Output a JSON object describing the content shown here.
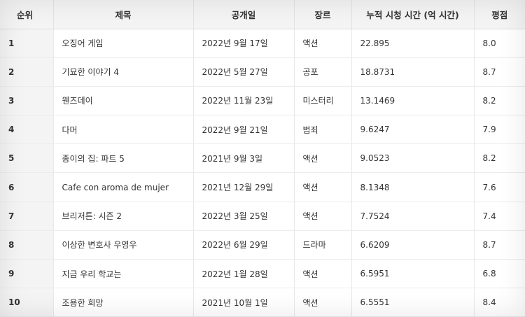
{
  "table": {
    "headers": [
      "순위",
      "제목",
      "공개일",
      "장르",
      "누적 시청 시간 (억 시간)",
      "평점"
    ],
    "rows": [
      [
        "1",
        "오징어 게임",
        "2022년 9월 17일",
        "액션",
        "22.895",
        "8.0"
      ],
      [
        "2",
        "기묘한 이야기 4",
        "2022년 5월 27일",
        "공포",
        "18.8731",
        "8.7"
      ],
      [
        "3",
        "웬즈데이",
        "2022년 11월 23일",
        "미스터리",
        "13.1469",
        "8.2"
      ],
      [
        "4",
        "다머",
        "2022년 9월 21일",
        "범죄",
        "9.6247",
        "7.9"
      ],
      [
        "5",
        "종이의 집: 파트 5",
        "2021년 9월 3일",
        "액션",
        "9.0523",
        "8.2"
      ],
      [
        "6",
        "Cafe con aroma de mujer",
        "2021년 12월 29일",
        "액션",
        "8.1348",
        "7.6"
      ],
      [
        "7",
        "브리저튼: 시즌 2",
        "2022년 3월 25일",
        "액션",
        "7.7524",
        "7.4"
      ],
      [
        "8",
        "이상한 변호사 우영우",
        "2022년 6월 29일",
        "드라마",
        "6.6209",
        "8.7"
      ],
      [
        "9",
        "지금 우리 학교는",
        "2022년 1월 28일",
        "액션",
        "6.5951",
        "6.8"
      ],
      [
        "10",
        "조용한 희망",
        "2021년 10월 1일",
        "액션",
        "6.5551",
        "8.4"
      ]
    ]
  }
}
